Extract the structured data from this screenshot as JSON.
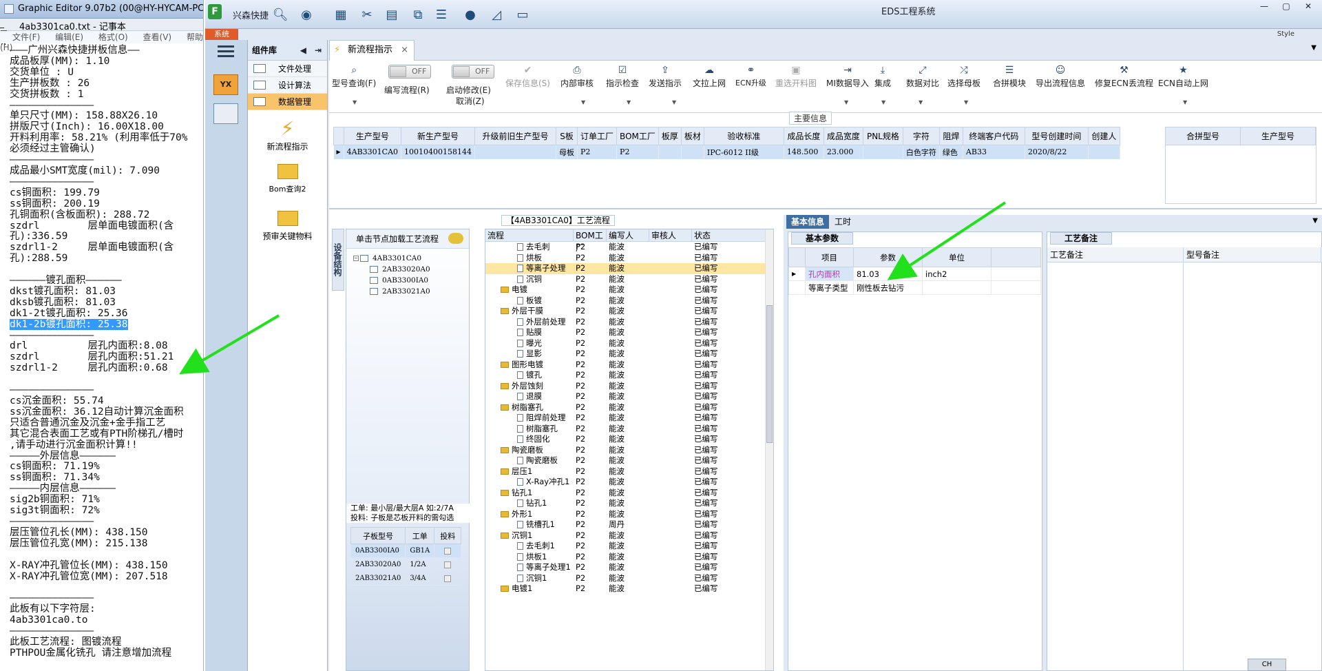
{
  "notepad": {
    "ge_title": "Graphic Editor 9.07b2 (00@HY-HYCAM-PC185",
    "title": "4ab3301ca0.txt - 记事本",
    "menu": [
      "文件(F)",
      "编辑(E)",
      "格式(O)",
      "查看(V)",
      "帮助(H)"
    ],
    "lines_before_hl": "———广州兴森快捷拼板信息——\n成品板厚(MM): 1.10\n交货单位 : U\n生产拼板数 : 26\n交货拼板数 : 1\n——————————————\n单只尺寸(MM): 158.88X26.10\n拼版尺寸(Inch): 16.00X18.00\n开料利用率: 58.21% (利用率低于70%\n必须经过主管确认)\n——————————————\n成品最小SMT宽度(mil): 7.090\n——————————————\ncs铜面积: 199.79\nss铜面积: 200.19\n孔铜面积(含板面积): 288.72\nszdrl        层单面电镀面积(含\n孔):336.59\nszdrl1-2     层单面电镀面积(含\n孔):288.59\n\n——————镀孔面积——————\ndkst镀孔面积: 81.03\ndksb镀孔面积: 81.03\ndk1-2t镀孔面积: 25.36\n",
    "highlight": "dk1-2b镀孔面积: 25.38",
    "lines_after_hl": "\n——————————————\ndrl          层孔内面积:8.08\nszdrl        层孔内面积:51.21\nszdrl1-2     层孔内面积:0.68\n\n——————————————\ncs沉金面积: 55.74\nss沉金面积: 36.12自动计算沉金面积\n只适合普通沉金及沉金+金手指工艺\n其它混合表面工艺或有PTH阶梯孔/槽时\n,请手动进行沉金面积计算!!\n—————外层信息——————\ncs铜面积: 71.19%\nss铜面积: 71.34%\n—————内层信息——————\nsig2b铜面积: 71%\nsig3t铜面积: 72%\n——————————————\n层压管位孔长(MM): 438.150\n层压管位孔宽(MM): 215.138\n\nX-RAY冲孔管位长(MM): 438.150\nX-RAY冲孔管位宽(MM): 207.518\n\n——————————————\n此板有以下字符层:\n4ab3301ca0.to\n——————————————\n此板工艺流程: 图镀流程\nPTHPOU金属化铣孔 请注意增加流程"
  },
  "eds": {
    "app_title": "EDS工程系统",
    "app_name": "兴森快捷",
    "sys_label": "系统",
    "style_label": "Style",
    "library_title": "组件库",
    "library_items": [
      "文件处理",
      "设计算法",
      "数据管理"
    ],
    "library_tools": [
      "新流程指示",
      "Bom查询2",
      "预审关键物料"
    ],
    "tab_label": "新流程指示",
    "toolbar": {
      "model_query": "型号查询(F)",
      "edit_flow": "编写流程(R)",
      "start_modify": "启动修改(E)",
      "cancel": "取消(Z)",
      "toggle_off": "OFF",
      "save_info": "保存信息(S)",
      "internal_review": "内部审核",
      "instruction_check": "指示检查",
      "send_instruction": "发送指示",
      "upload_doc": "文拉上网",
      "ecn_upgrade": "ECN升级",
      "reselect_cut": "重选开料图",
      "mi_import": "MI数据导入",
      "integrate": "集成",
      "data_compare": "数据对比",
      "select_master": "选择母板",
      "merge_module": "合拼模块",
      "export_flow": "导出流程信息",
      "fix_ecn": "修复ECN丢流程",
      "ecn_auto_upload": "ECN自动上网"
    },
    "main_info_title": "主要信息",
    "main_columns": [
      "生产型号",
      "新生产型号",
      "升级前旧生产型号",
      "S板",
      "订单工厂",
      "BOM工厂",
      "板厚",
      "板材",
      "验收标准",
      "成品长度",
      "成品宽度",
      "PNL规格",
      "字符",
      "阻焊",
      "终端客户代码",
      "型号创建时间",
      "创建人"
    ],
    "main_row": [
      "4AB3301CA0",
      "10010400158144",
      "",
      "母板",
      "P2",
      "P2",
      "",
      "",
      "IPC-6012 II级",
      "148.500",
      "23.000",
      "",
      "白色字符",
      "绿色",
      "AB33",
      "2020/8/22",
      ""
    ],
    "side_columns": [
      "合拼型号",
      "生产型号"
    ],
    "process_title": "【4AB3301CA0】工艺流程",
    "vertical_tab": "设备结构",
    "tree_hint": "单击节点加载工艺流程",
    "tree_nodes": [
      "4AB3301CA0",
      "2AB33020A0",
      "0AB3300IA0",
      "2AB33021A0"
    ],
    "layer_note": "工单: 最小层/最大层A 如:2/7A\n投料: 子板是芯板开料的需勾选",
    "sub_columns": [
      "子板型号",
      "工单",
      "投料"
    ],
    "sub_rows": [
      [
        "0AB3300IA0",
        "GB1A"
      ],
      [
        "2AB33020A0",
        "1/2A"
      ],
      [
        "2AB33021A0",
        "3/4A"
      ]
    ],
    "flow_columns": [
      "流程",
      "BOM工厂",
      "编写人",
      "审核人",
      "状态"
    ],
    "flow_rows": [
      {
        "name": "去毛刺",
        "lv": 2,
        "fac": "P2",
        "writer": "能波",
        "status": "已编写"
      },
      {
        "name": "烘板",
        "lv": 2,
        "fac": "P2",
        "writer": "能波",
        "status": "已编写"
      },
      {
        "name": "等离子处理",
        "lv": 2,
        "fac": "P2",
        "writer": "能波",
        "status": "已编写",
        "sel": true
      },
      {
        "name": "沉铜",
        "lv": 2,
        "fac": "P2",
        "writer": "能波",
        "status": "已编写"
      },
      {
        "name": "电镀",
        "lv": 1,
        "fac": "P2",
        "writer": "能波",
        "status": "已编写"
      },
      {
        "name": "板镀",
        "lv": 2,
        "fac": "P2",
        "writer": "能波",
        "status": "已编写"
      },
      {
        "name": "外层干膜",
        "lv": 1,
        "fac": "P2",
        "writer": "能波",
        "status": "已编写"
      },
      {
        "name": "外层前处理",
        "lv": 2,
        "fac": "P2",
        "writer": "能波",
        "status": "已编写"
      },
      {
        "name": "贴膜",
        "lv": 2,
        "fac": "P2",
        "writer": "能波",
        "status": "已编写"
      },
      {
        "name": "曝光",
        "lv": 2,
        "fac": "P2",
        "writer": "能波",
        "status": "已编写"
      },
      {
        "name": "显影",
        "lv": 2,
        "fac": "P2",
        "writer": "能波",
        "status": "已编写"
      },
      {
        "name": "图形电镀",
        "lv": 1,
        "fac": "P2",
        "writer": "能波",
        "status": "已编写"
      },
      {
        "name": "镀孔",
        "lv": 2,
        "fac": "P2",
        "writer": "能波",
        "status": "已编写"
      },
      {
        "name": "外层蚀刻",
        "lv": 1,
        "fac": "P2",
        "writer": "能波",
        "status": "已编写"
      },
      {
        "name": "退膜",
        "lv": 2,
        "fac": "P2",
        "writer": "能波",
        "status": "已编写"
      },
      {
        "name": "树脂塞孔",
        "lv": 1,
        "fac": "P2",
        "writer": "能波",
        "status": "已编写"
      },
      {
        "name": "阻焊前处理",
        "lv": 2,
        "fac": "P2",
        "writer": "能波",
        "status": "已编写"
      },
      {
        "name": "树脂塞孔",
        "lv": 2,
        "fac": "P2",
        "writer": "能波",
        "status": "已编写"
      },
      {
        "name": "终固化",
        "lv": 2,
        "fac": "P2",
        "writer": "能波",
        "status": "已编写"
      },
      {
        "name": "陶瓷磨板",
        "lv": 1,
        "fac": "P2",
        "writer": "能波",
        "status": "已编写"
      },
      {
        "name": "陶瓷磨板",
        "lv": 2,
        "fac": "P2",
        "writer": "能波",
        "status": "已编写"
      },
      {
        "name": "层压1",
        "lv": 1,
        "fac": "P2",
        "writer": "能波",
        "status": "已编写"
      },
      {
        "name": "X-Ray冲孔1",
        "lv": 2,
        "fac": "P2",
        "writer": "能波",
        "status": "已编写"
      },
      {
        "name": "钻孔1",
        "lv": 1,
        "fac": "P2",
        "writer": "能波",
        "status": "已编写"
      },
      {
        "name": "钻孔1",
        "lv": 2,
        "fac": "P2",
        "writer": "能波",
        "status": "已编写"
      },
      {
        "name": "外形1",
        "lv": 1,
        "fac": "P2",
        "writer": "能波",
        "status": "已编写"
      },
      {
        "name": "铣槽孔1",
        "lv": 2,
        "fac": "P2",
        "writer": "周丹",
        "status": "已编写"
      },
      {
        "name": "沉铜1",
        "lv": 1,
        "fac": "P2",
        "writer": "能波",
        "status": "已编写"
      },
      {
        "name": "去毛刺1",
        "lv": 2,
        "fac": "P2",
        "writer": "能波",
        "status": "已编写"
      },
      {
        "name": "烘板1",
        "lv": 2,
        "fac": "P2",
        "writer": "能波",
        "status": "已编写"
      },
      {
        "name": "等离子处理1",
        "lv": 2,
        "fac": "P2",
        "writer": "能波",
        "status": "已编写"
      },
      {
        "name": "沉铜1",
        "lv": 2,
        "fac": "P2",
        "writer": "能波",
        "status": "已编写"
      },
      {
        "name": "电镀1",
        "lv": 1,
        "fac": "P2",
        "writer": "能波",
        "status": "已编写"
      }
    ],
    "detail_tabs": [
      "基本信息",
      "工时"
    ],
    "basic_params_tab": "基本参数",
    "param_columns": [
      "项目",
      "参数",
      "单位"
    ],
    "param_rows": [
      [
        "孔内面积",
        "81.03",
        "inch2"
      ],
      [
        "等离子类型",
        "刚性板去钻污",
        ""
      ]
    ],
    "craft_note_tab": "工艺备注",
    "note_columns": [
      "工艺备注",
      "型号备注"
    ],
    "ime": "CH"
  }
}
